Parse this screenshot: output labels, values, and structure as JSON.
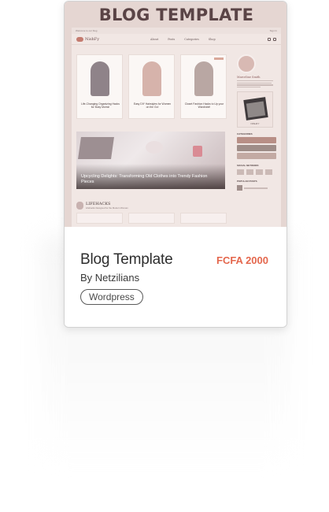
{
  "card": {
    "banner_title": "BLOG TEMPLATE",
    "title": "Blog Template",
    "price": "FCFA 2000",
    "author": "By Netzilians",
    "category_badge": "Wordpress"
  },
  "preview": {
    "topbar_left": "Welcome to our blog",
    "topbar_right": "Sign In",
    "logo_text": "NishFy",
    "menu": [
      "About",
      "Posts",
      "Categories",
      "Shop"
    ],
    "posts": [
      {
        "tag": "",
        "caption": "Life-Changing Organizing Hacks for Busy Moms!"
      },
      {
        "tag": "",
        "caption": "Easy DIY Hairstyles for Women on the Go!"
      },
      {
        "tag": "",
        "caption": "Closet Fashion Hacks to Up your Wardrobe!"
      }
    ],
    "feature_title": "Upcycling Delights: Transforming Old Clothes into Trendy Fashion Pieces",
    "lifehacks_title": "LIFEHACKS",
    "lifehacks_sub": "Lifehacks Designed for the Modern Woman",
    "sidebar_name": "Marceline Smith",
    "book_label": "NISHFY",
    "sidebar_categories": "CATEGORIES",
    "sidebar_social": "SOCIAL NETWORK",
    "sidebar_popular": "POPULAR POSTS"
  },
  "colors": {
    "price": "#e4674d",
    "preview_bg": "#e5d6d2",
    "banner_text": "#5a4446"
  }
}
